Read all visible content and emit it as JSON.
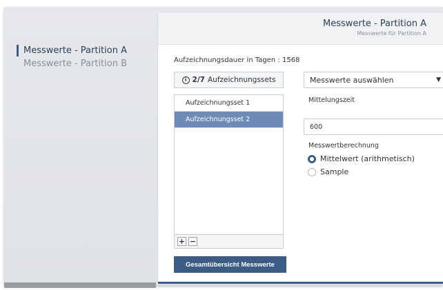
{
  "sidebar": {
    "items": [
      {
        "label": "Messwerte - Partition A",
        "active": true
      },
      {
        "label": "Messwerte - Partition B",
        "active": false
      }
    ]
  },
  "header": {
    "title": "Messwerte - Partition A",
    "subtitle": "Messwerte für Partition A"
  },
  "duration_label": "Aufzeichnungsdauer in Tagen : 1568",
  "sets": {
    "count_bold": "2/7",
    "count_label": "Aufzeichnungssets",
    "items": [
      {
        "label": "Aufzeichnungsset 1",
        "selected": false
      },
      {
        "label": "Aufzeichnungsset 2",
        "selected": true
      }
    ],
    "add_label": "+",
    "remove_label": "−"
  },
  "overview_button": "Gesamtübersicht Messwerte",
  "measure_select": {
    "value": "Messwerte auswählen"
  },
  "averaging": {
    "label": "Mittelungszeit",
    "value": "600"
  },
  "calculation": {
    "label": "Messwertberechnung",
    "options": [
      {
        "label": "Mittelwert (arithmetisch)",
        "checked": true
      },
      {
        "label": "Sample",
        "checked": false
      }
    ]
  },
  "colors": {
    "accent": "#3b5d85",
    "selected_row": "#6d8bb5"
  }
}
